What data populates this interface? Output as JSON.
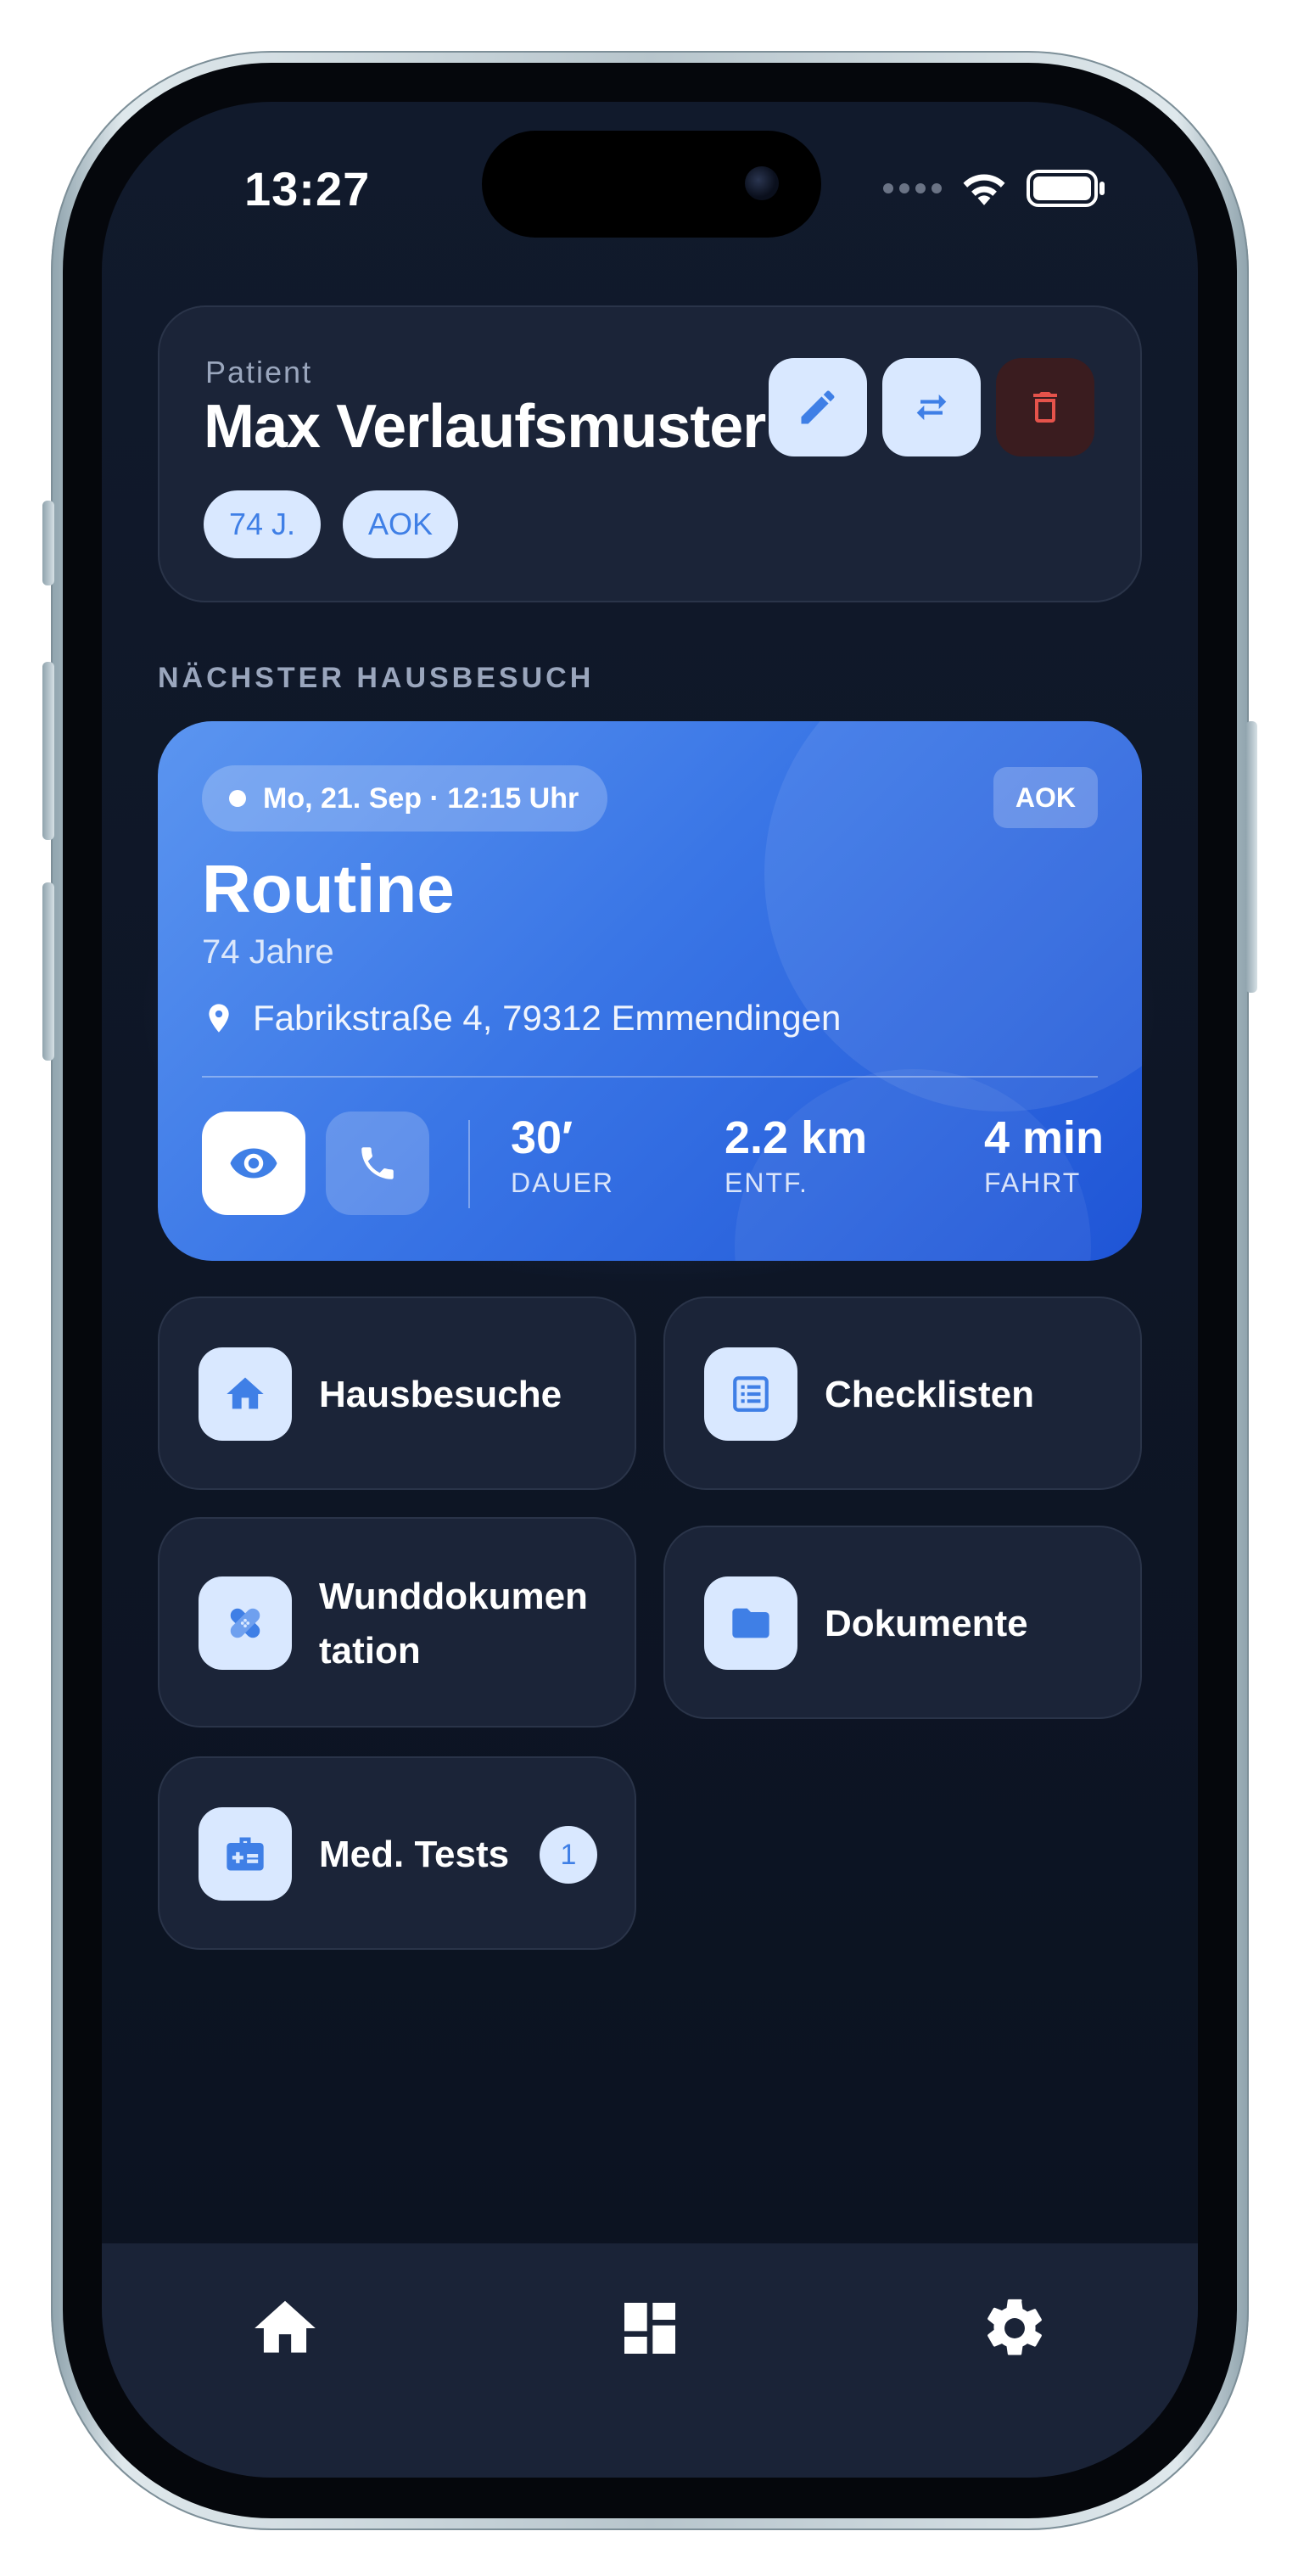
{
  "status_bar": {
    "time": "13:27"
  },
  "patient": {
    "label": "Patient",
    "name": "Max Verlaufsmuster",
    "age_chip": "74 J.",
    "insurer_chip": "AOK"
  },
  "section_label": "NÄCHSTER HAUSBESUCH",
  "next_visit": {
    "datetime": "Mo, 21. Sep · 12:15 Uhr",
    "insurer": "AOK",
    "title": "Routine",
    "age": "74 Jahre",
    "address": "Fabrikstraße 4, 79312 Emmendingen",
    "stats": [
      {
        "value": "30′",
        "label": "DAUER"
      },
      {
        "value": "2.2 km",
        "label": "ENTF."
      },
      {
        "value": "4 min",
        "label": "FAHRT"
      }
    ]
  },
  "tiles": [
    {
      "label": "Hausbesuche",
      "icon": "home-icon"
    },
    {
      "label": "Checklisten",
      "icon": "list-icon"
    },
    {
      "label_line1": "Wunddokumen",
      "label_line2": "tation",
      "icon": "bandage-icon"
    },
    {
      "label": "Dokumente",
      "icon": "folder-icon"
    },
    {
      "label": "Med. Tests",
      "icon": "medical-kit-icon",
      "badge": "1"
    }
  ],
  "nav": [
    "home-icon",
    "dashboard-icon",
    "settings-icon"
  ],
  "colors": {
    "background": "#0e1626",
    "card": "#1b2438",
    "accent": "#3f7fe6",
    "accent_light": "#d9e8ff",
    "danger": "#e5534b"
  }
}
